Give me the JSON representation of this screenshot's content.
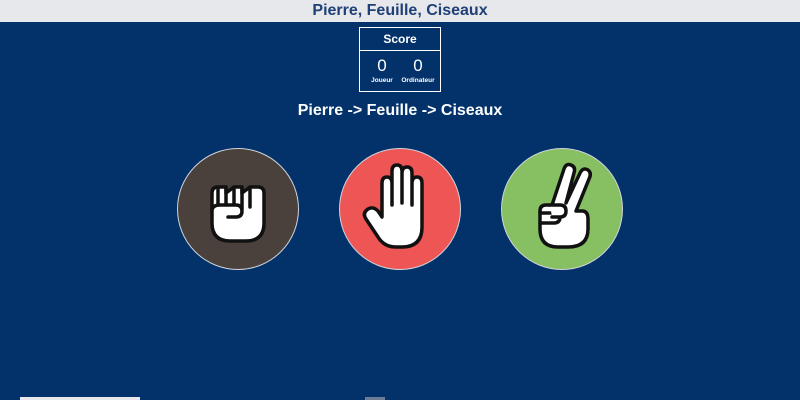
{
  "window": {
    "title": "Pierre, Feuille, Ciseaux"
  },
  "score": {
    "title": "Score",
    "player_value": "0",
    "player_label": "Joueur",
    "computer_value": "0",
    "computer_label": "Ordinateur"
  },
  "rules_text": "Pierre -> Feuille -> Ciseaux",
  "choices": [
    {
      "name": "Pierre",
      "icon": "rock-hand-icon",
      "color": "#4a413d"
    },
    {
      "name": "Feuille",
      "icon": "paper-hand-icon",
      "color": "#ee5656"
    },
    {
      "name": "Ciseaux",
      "icon": "scissors-hand-icon",
      "color": "#86c062"
    }
  ],
  "colors": {
    "background": "#03326b",
    "titlebar": "#e6e8eb",
    "title_text": "#1f3f77"
  }
}
